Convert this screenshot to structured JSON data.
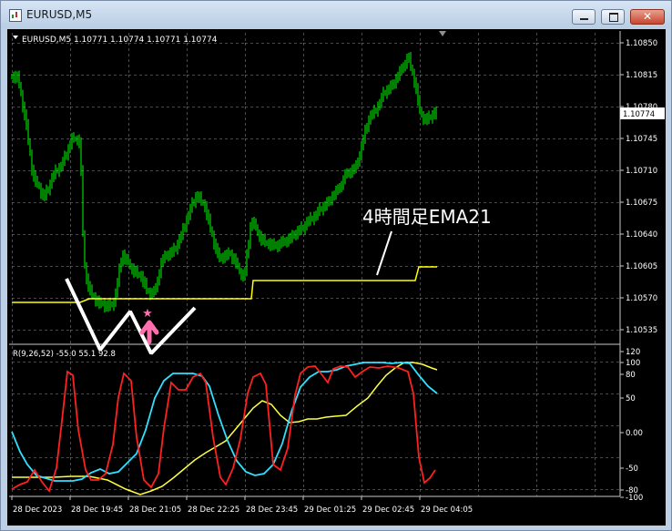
{
  "window": {
    "title": "EURUSD,M5",
    "icon": "chart-window-icon",
    "minimize_icon": "minimize-icon",
    "maximize_icon": "maximize-icon",
    "close_label": "✕"
  },
  "chart": {
    "header": "EURUSD,M5  1.10771 1.10774 1.10771 1.10774",
    "collapse_icon": "triangle-down-icon",
    "price_axis_ticks": [
      "1.10850",
      "1.10815",
      "1.10780",
      "1.10745",
      "1.10710",
      "1.10675",
      "1.10640",
      "1.10605",
      "1.10570",
      "1.10535"
    ],
    "current_price": "1.10774",
    "time_axis_ticks": [
      "28 Dec 2023",
      "28 Dec 19:45",
      "28 Dec 21:05",
      "28 Dec 22:25",
      "28 Dec 23:45",
      "29 Dec 01:25",
      "29 Dec 02:45",
      "29 Dec 04:05"
    ],
    "annotation": "4時間足EMA21",
    "colors": {
      "background": "#000000",
      "candles": "#00ff00",
      "ema": "#ffff00",
      "grid": "#9a9a9a",
      "annotation": "#ffffff",
      "marker": "#ff6fae"
    }
  },
  "indicator": {
    "label": "R(9,26,52) -55.0 55.1 92.8",
    "axis_ticks": [
      "120",
      "100",
      "80",
      "50",
      "0.00",
      "-50",
      "-80",
      "-100"
    ],
    "colors": {
      "fast": "#ff2020",
      "mid": "#30e0ff",
      "slow": "#ffff40"
    }
  }
}
